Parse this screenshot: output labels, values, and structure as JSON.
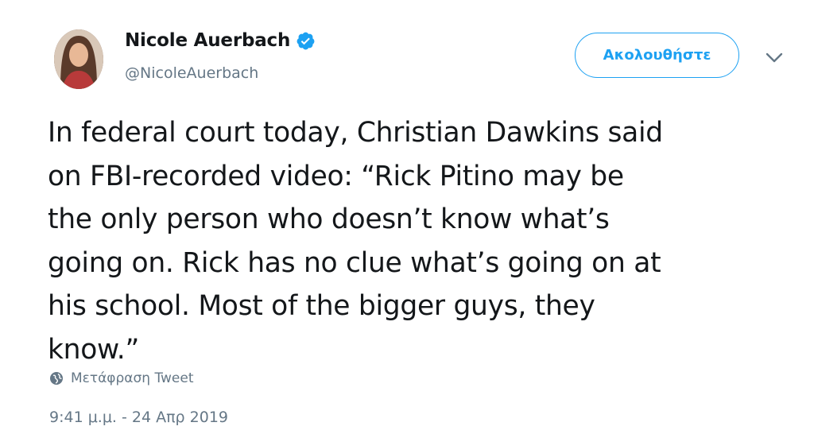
{
  "author": {
    "display_name": "Nicole Auerbach",
    "handle": "@NicoleAuerbach",
    "verified": true
  },
  "follow_button": {
    "label": "Ακολουθήστε"
  },
  "menu": {
    "icon": "chevron-down-icon"
  },
  "tweet": {
    "text": [
      "In federal court today, Christian Dawkins said",
      "on FBI-recorded video: “Rick Pitino may be",
      "the only person who doesn’t know what’s",
      "going on. Rick has no clue what’s going on at",
      "his school. Most of the bigger guys, they",
      "know.”"
    ]
  },
  "translate": {
    "label": "Μετάφραση Tweet",
    "icon": "globe-icon"
  },
  "timestamp": "9:41 μ.μ. - 24 Απρ 2019",
  "colors": {
    "accent": "#1da1f2",
    "muted": "#657786",
    "text": "#14171a"
  }
}
